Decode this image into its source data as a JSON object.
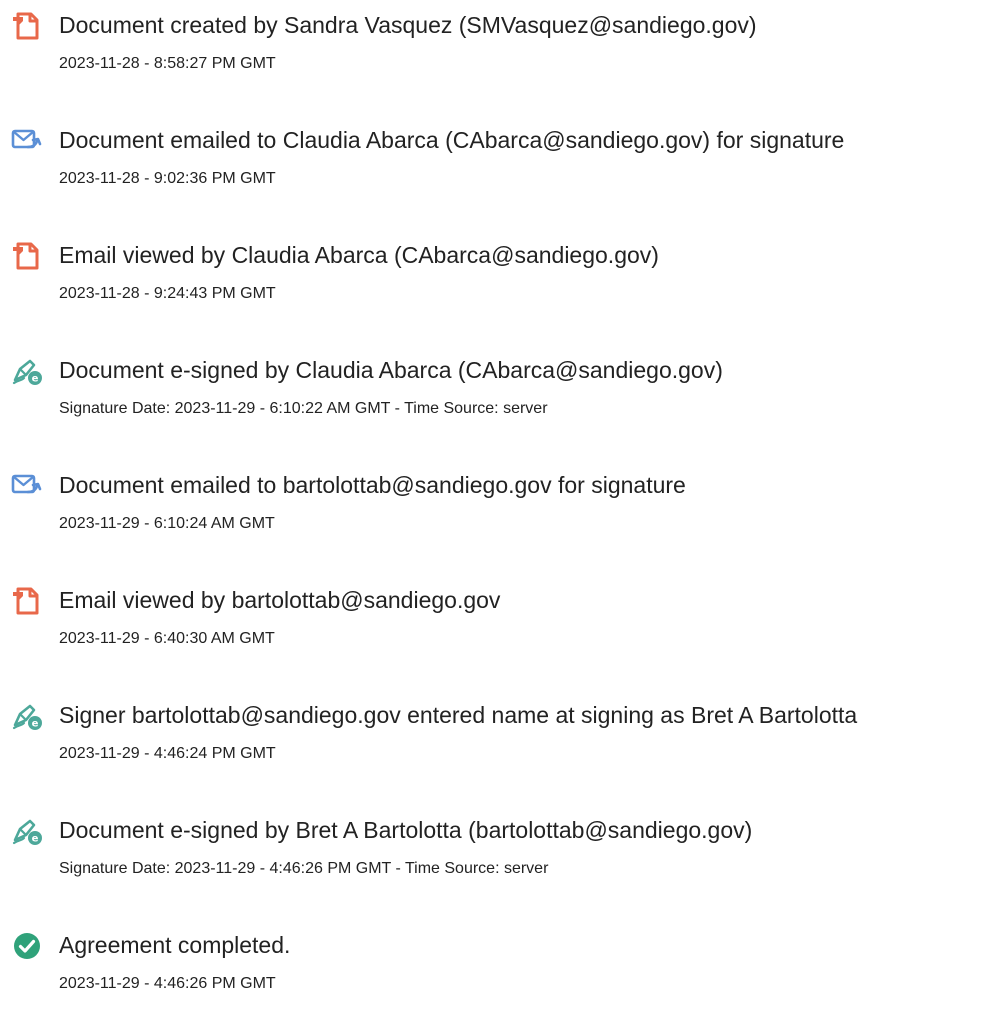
{
  "colors": {
    "document_icon": "#e8684a",
    "email_icon": "#5b8fd6",
    "sign_icon": "#4da89a",
    "complete_icon": "#2fa27a",
    "text": "#222222"
  },
  "events": [
    {
      "icon": "document-icon",
      "title": "Document created by Sandra Vasquez (SMVasquez@sandiego.gov)",
      "subtitle": "2023-11-28 - 8:58:27 PM GMT"
    },
    {
      "icon": "email-icon",
      "title": "Document emailed to Claudia Abarca (CAbarca@sandiego.gov) for signature",
      "subtitle": "2023-11-28 - 9:02:36 PM GMT"
    },
    {
      "icon": "document-icon",
      "title": "Email viewed by Claudia Abarca (CAbarca@sandiego.gov)",
      "subtitle": "2023-11-28 - 9:24:43 PM GMT"
    },
    {
      "icon": "esign-icon",
      "title": "Document e-signed by Claudia Abarca (CAbarca@sandiego.gov)",
      "subtitle": "Signature Date: 2023-11-29 - 6:10:22 AM GMT - Time Source: server"
    },
    {
      "icon": "email-icon",
      "title": "Document emailed to bartolottab@sandiego.gov for signature",
      "subtitle": "2023-11-29 - 6:10:24 AM GMT"
    },
    {
      "icon": "document-icon",
      "title": "Email viewed by bartolottab@sandiego.gov",
      "subtitle": "2023-11-29 - 6:40:30 AM GMT"
    },
    {
      "icon": "esign-icon",
      "title": "Signer bartolottab@sandiego.gov entered name at signing as Bret A Bartolotta",
      "subtitle": "2023-11-29 - 4:46:24 PM GMT"
    },
    {
      "icon": "esign-icon",
      "title": "Document e-signed by Bret A Bartolotta (bartolottab@sandiego.gov)",
      "subtitle": "Signature Date: 2023-11-29 - 4:46:26 PM GMT - Time Source: server"
    },
    {
      "icon": "checkmark-icon",
      "title": "Agreement completed.",
      "subtitle": "2023-11-29 - 4:46:26 PM GMT"
    }
  ]
}
